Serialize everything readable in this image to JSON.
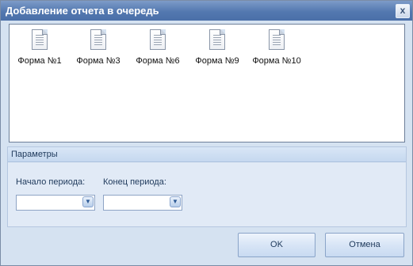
{
  "window": {
    "title": "Добавление отчета в очередь",
    "close_glyph": "x"
  },
  "reports": {
    "items": [
      {
        "label": "Форма №1",
        "icon": "document-icon"
      },
      {
        "label": "Форма №3",
        "icon": "document-icon"
      },
      {
        "label": "Форма №6",
        "icon": "document-icon"
      },
      {
        "label": "Форма №9",
        "icon": "document-icon"
      },
      {
        "label": "Форма №10",
        "icon": "document-icon"
      }
    ]
  },
  "params": {
    "title": "Параметры",
    "start_label": "Начало периода:",
    "end_label": "Конец периода:",
    "start_value": "",
    "end_value": ""
  },
  "buttons": {
    "ok": "OK",
    "cancel": "Отмена"
  },
  "colors": {
    "titlebar": "#5378b0",
    "panel": "#d5e2f1",
    "accent": "#2d5a95"
  }
}
